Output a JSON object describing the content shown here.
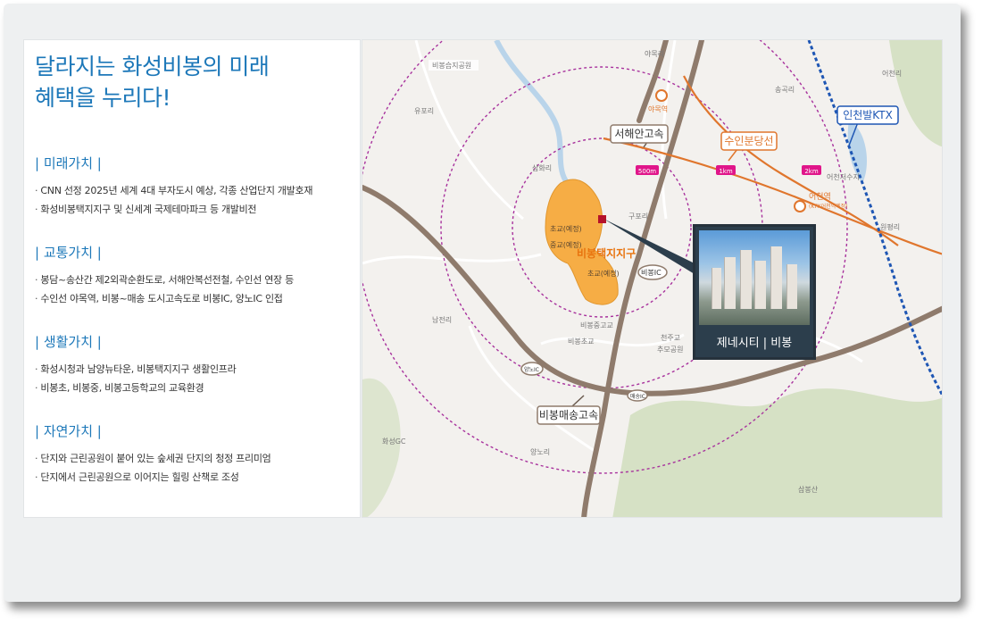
{
  "headline": [
    "달라지는 화성비봉의 미래",
    "혜택을 누리다!"
  ],
  "sections": [
    {
      "title": "| 미래가치 |",
      "items": [
        "CNN 선정 2025년 세계 4대 부자도시 예상, 각종 산업단지 개발호재",
        "화성비봉택지지구 및 신세계 국제테마파크 등 개발비전"
      ]
    },
    {
      "title": "| 교통가치 |",
      "items": [
        "봉담~송산간 제2외곽순환도로, 서해안복선전철, 수인선 연장 등",
        "수인선 야목역, 비봉~매송 도시고속도로 비봉IC, 양노IC 인접"
      ]
    },
    {
      "title": "| 생활가치 |",
      "items": [
        "화성시청과 남양뉴타운, 비봉택지지구 생활인프라",
        "비봉초, 비봉중, 비봉고등학교의 교육환경"
      ]
    },
    {
      "title": "| 자연가치 |",
      "items": [
        "단지와 근린공원이 붙어 있는 숲세권 단지의 청정 프리미엄",
        "단지에서 근린공원으로 이어지는 힐링 산책로 조성"
      ]
    }
  ],
  "map": {
    "labels": {
      "park_bibongseupji": "비봉습지공원",
      "yupori": "유포리",
      "ayangri": "야목리",
      "songgokri": "송곡리",
      "eocheonri": "어천리",
      "samhwari": "삼화리",
      "gupori": "구포리",
      "wonpyeongri": "원평리",
      "namjeonri": "남전리",
      "yangnori": "양노리",
      "hwaseong_gc": "화성GC",
      "sambongsan": "삼봉산",
      "eocheon_reservoir": "어천저수지",
      "bibong_high": "비봉중고교",
      "bibong_elem": "비봉초교",
      "cheonjugyo": "천주교",
      "chumo_park": "추모공원",
      "school_elem1": "초교(예정)",
      "school_mid": "중교(예정)",
      "school_elem2": "초교(예정)",
      "district": "비봉택지지구",
      "bibong_ic": "비봉IC",
      "yangno_ic": "양노IC",
      "maesong_ic": "매송IC"
    },
    "stations": {
      "yamok": "야목역",
      "eocheon": "어천역",
      "eocheon_sub": "(KTX어천역예정)"
    },
    "callouts": {
      "seohaean": "서해안고속",
      "suin": "수인분당선",
      "ktx": "인천발KTX",
      "maesong_hwy": "비봉매송고속"
    },
    "distances": [
      "500m",
      "1km",
      "2km"
    ],
    "colors": {
      "rail": "#e0762d",
      "road": "#8f7b6c",
      "ring": "#a8329d",
      "ktx": "#1e56b4",
      "district_fill": "#f6ad45",
      "district_text": "#e8740f",
      "badge": "#e0168a",
      "water": "#b9d4ea",
      "forest": "#d2dec0"
    }
  },
  "callout_building": {
    "label": "제네시티 | 비봉"
  }
}
